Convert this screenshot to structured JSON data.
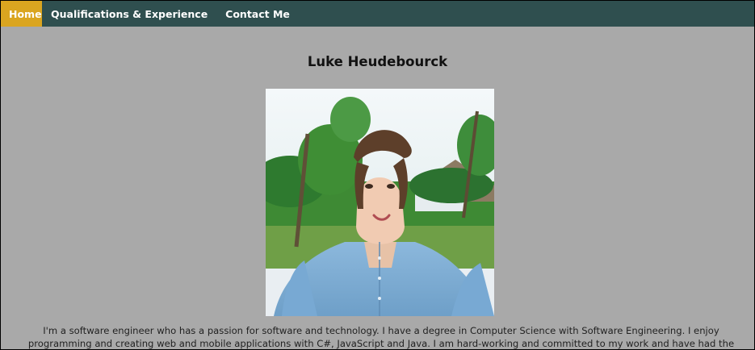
{
  "nav": {
    "items": [
      {
        "label": "Home",
        "active": true
      },
      {
        "label": "Qualifications & Experience",
        "active": false
      },
      {
        "label": "Contact Me",
        "active": false
      }
    ]
  },
  "main": {
    "title": "Luke Heudebourck",
    "photo_icon": "profile-photo",
    "bio": "I'm a software engineer who has a passion for software and technology. I have a degree in Computer Science with Software Engineering. I enjoy programming and creating web and mobile applications with C#, JavaScript and Java. I am hard-working and committed to my work and have had the opportunity to work with organisations like Sparta Global, BDO,"
  },
  "colors": {
    "navbar": "#2f4f4f",
    "active_tab": "#daa520",
    "page_background": "#a9a9a9"
  }
}
